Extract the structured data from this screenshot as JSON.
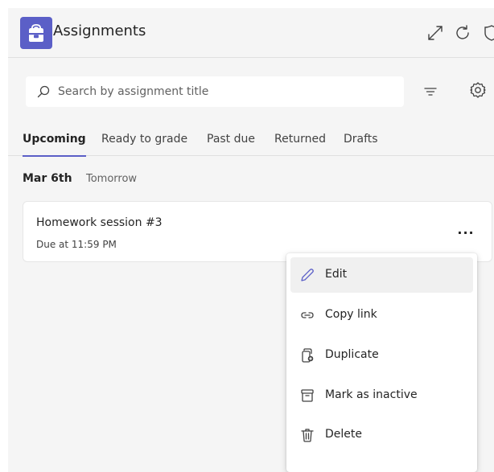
{
  "app": {
    "title": "Assignments",
    "accent_color": "#5b5fc7",
    "logo_icon": "backpack-icon",
    "header_icons": [
      "expand-icon",
      "refresh-icon",
      "shield-icon"
    ]
  },
  "search": {
    "placeholder": "Search by assignment title",
    "value": ""
  },
  "toolbar": {
    "filter_icon": "filter-icon",
    "settings_icon": "gear-icon"
  },
  "tabs": [
    {
      "label": "Upcoming",
      "active": true
    },
    {
      "label": "Ready to grade",
      "active": false
    },
    {
      "label": "Past due",
      "active": false
    },
    {
      "label": "Returned",
      "active": false
    },
    {
      "label": "Drafts",
      "active": false
    }
  ],
  "group": {
    "date": "Mar 6th",
    "relative": "Tomorrow"
  },
  "assignment": {
    "title": "Homework session #3",
    "due": "Due at 11:59 PM",
    "more_label": "..."
  },
  "context_menu": {
    "items": [
      {
        "label": "Edit",
        "icon": "pencil-icon",
        "highlighted": true
      },
      {
        "label": "Copy link",
        "icon": "link-icon",
        "highlighted": false
      },
      {
        "label": "Duplicate",
        "icon": "duplicate-icon",
        "highlighted": false
      },
      {
        "label": "Mark as inactive",
        "icon": "archive-icon",
        "highlighted": false
      },
      {
        "label": "Delete",
        "icon": "trash-icon",
        "highlighted": false
      }
    ]
  }
}
